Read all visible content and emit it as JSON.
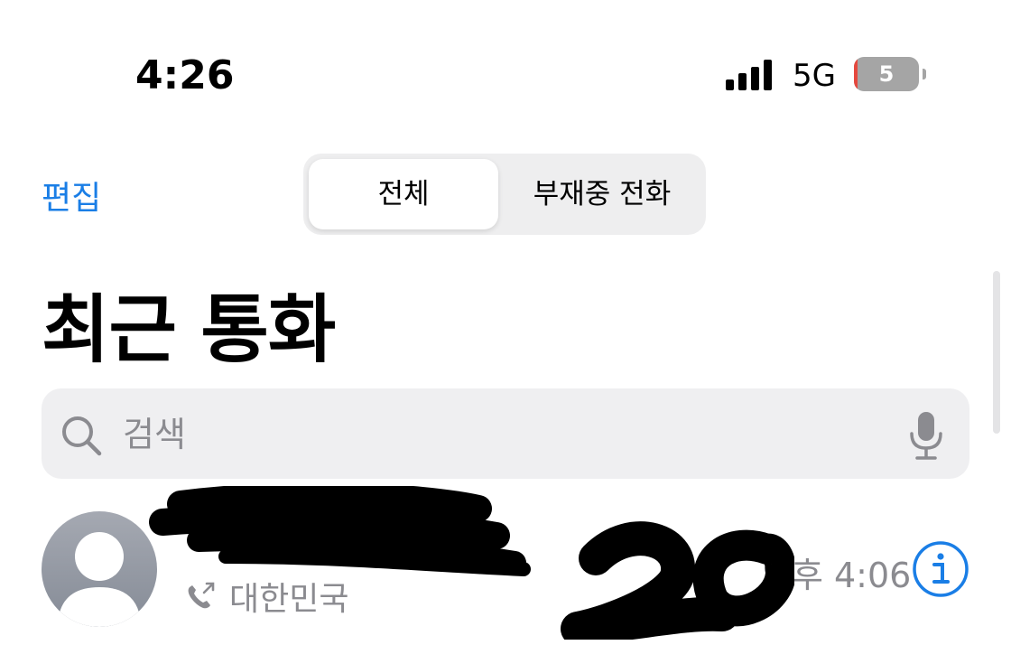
{
  "status_bar": {
    "time": "4:26",
    "network": "5G",
    "battery_level": "5"
  },
  "nav": {
    "edit_label": "편집",
    "segments": [
      {
        "label": "전체",
        "selected": true
      },
      {
        "label": "부재중 전화",
        "selected": false
      }
    ]
  },
  "page_title": "최근 통화",
  "search": {
    "placeholder": "검색"
  },
  "recents": [
    {
      "subtitle": "대한민국",
      "time": "오후 4:06"
    }
  ],
  "colors": {
    "accent": "#1a7ee6",
    "secondary_text": "#8b8b90",
    "search_background": "#efeff1",
    "battery_low": "#e5483e"
  },
  "icons": {
    "cellular": "signal-bars-icon",
    "battery": "battery-icon",
    "search": "magnifier-icon",
    "dictation": "microphone-icon",
    "contact": "person-avatar-icon",
    "outgoing_call": "outgoing-call-icon",
    "info": "info-circle-icon"
  }
}
